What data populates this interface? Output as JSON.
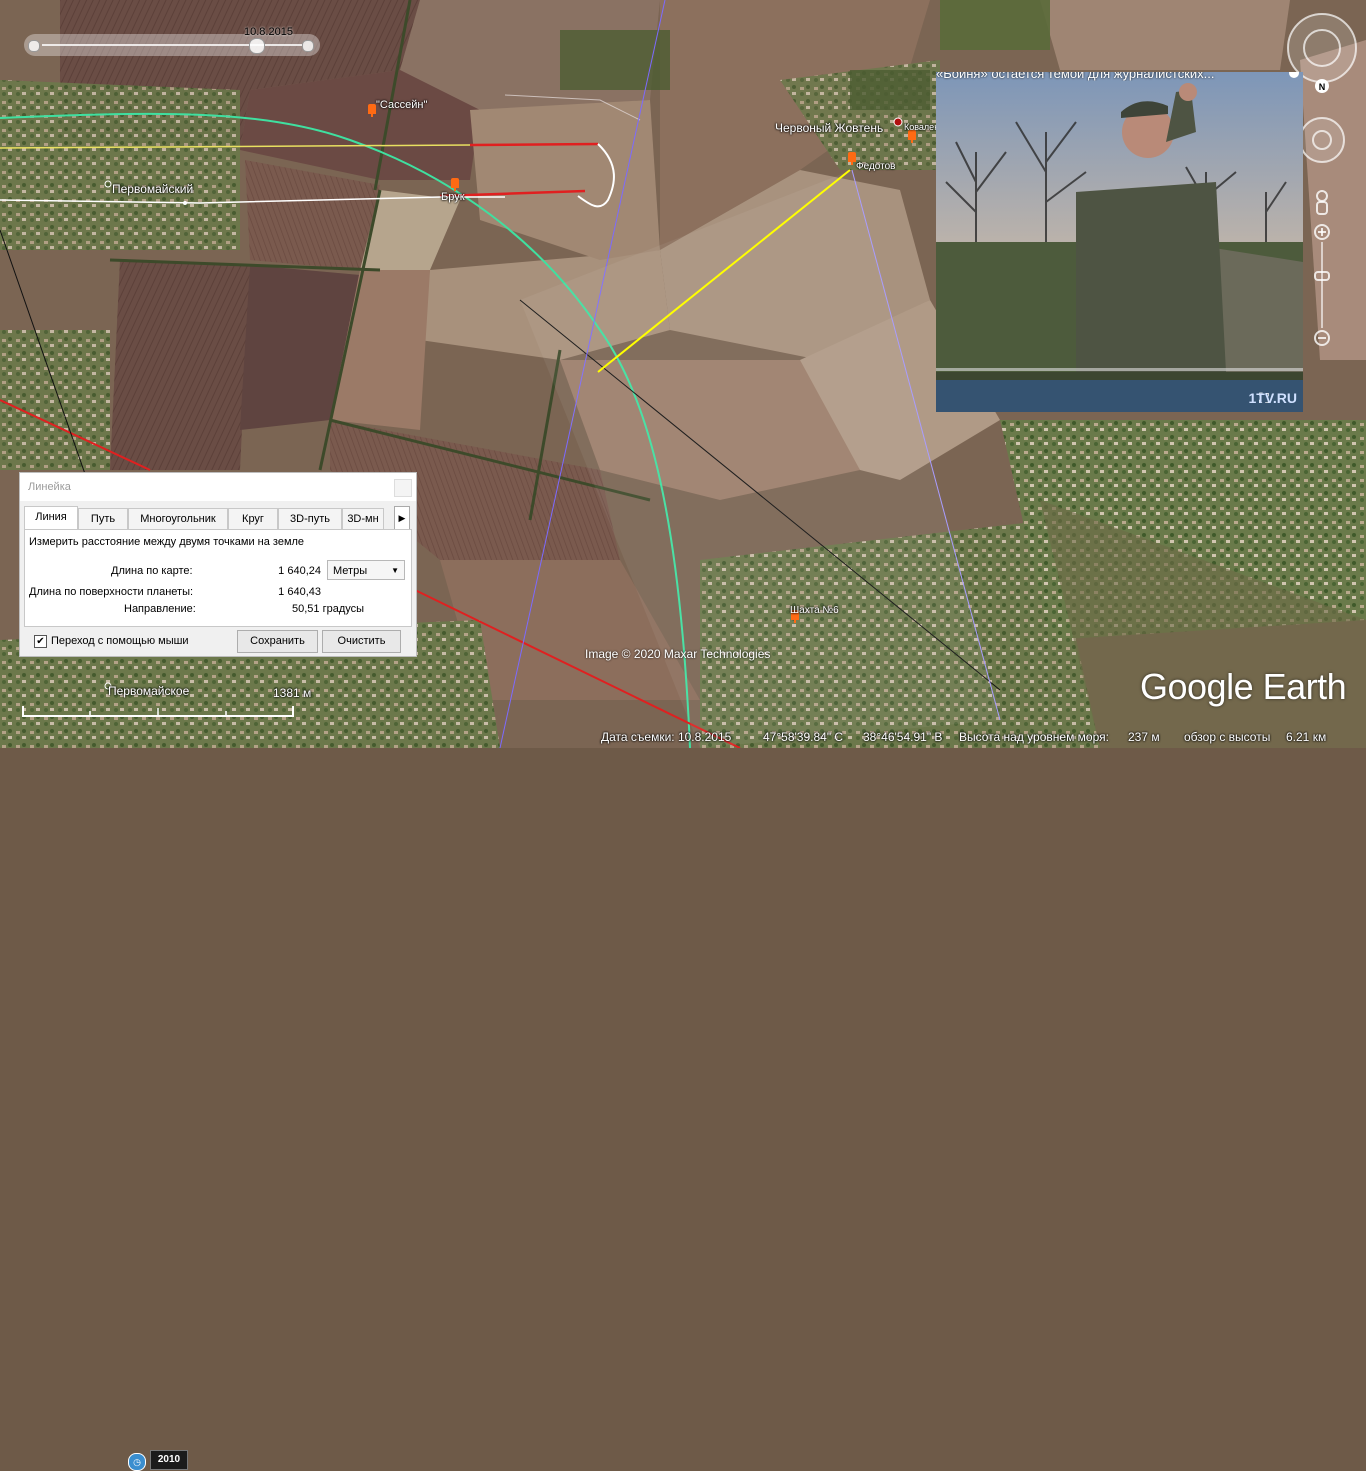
{
  "time_slider": {
    "date": "10.8.2015"
  },
  "map": {
    "labels": {
      "sassein": "Сассейн",
      "pervomaisky": "Первомайский",
      "bruk": "Брук",
      "chervony": "Червоный Жовтень",
      "kovalenko": "Коваленко",
      "fedotov": "Федотов",
      "pervomaiskoe": "Первомайское",
      "shakhta": "Шахта №6"
    },
    "copyright": "Image © 2020 Maxar Technologies",
    "logo": "Google Earth",
    "scale_label": "1381 м",
    "north_label": "N"
  },
  "video": {
    "title": "«Бойня» остается темой для журналистских...",
    "logo": "1TV.RU"
  },
  "ruler": {
    "title": "Линейка",
    "tabs": [
      "Линия",
      "Путь",
      "Многоугольник",
      "Круг",
      "3D-путь",
      "3D-мн"
    ],
    "description": "Измерить расстояние между двумя точками на земле",
    "map_length_label": "Длина по карте:",
    "map_length_value": "1 640,24",
    "units": "Метры",
    "surface_length_label": "Длина по поверхности планеты:",
    "surface_length_value": "1 640,43",
    "heading_label": "Направление:",
    "heading_value": "50,51 градусы",
    "mouse_nav_label": "Переход с помощью мыши",
    "save_label": "Сохранить",
    "clear_label": "Очистить"
  },
  "status": {
    "year": "2010",
    "imagery_date": "Дата съемки: 10.8.2015",
    "lat": "47°58'39.84\" С",
    "lon": "38°46'54.91\" В",
    "elevation_label": "Высота над уровнем моря:",
    "elevation_value": "237 м",
    "eye_alt_label": "обзор с высоты",
    "eye_alt_value": "6.21 км"
  },
  "colors": {
    "ruler_line": "#ffff00",
    "route_green": "#3fe0a0",
    "route_red": "#e02020"
  }
}
